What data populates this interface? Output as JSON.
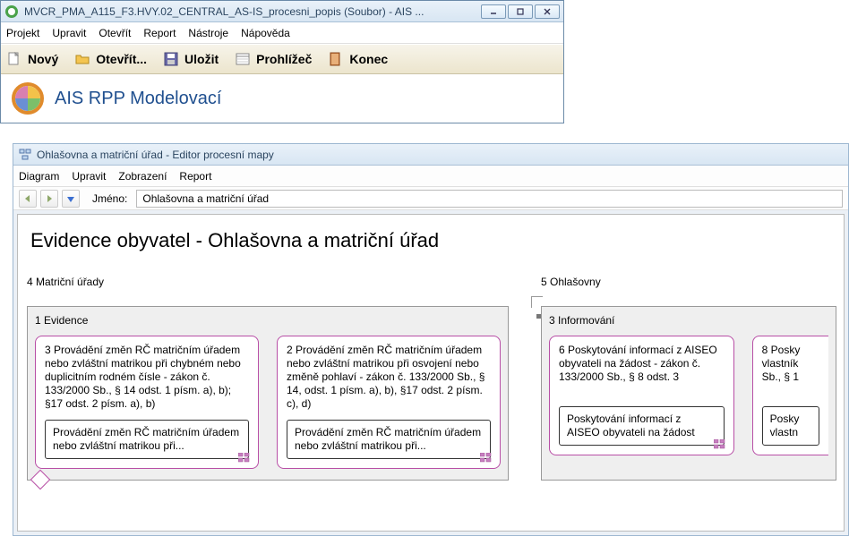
{
  "parentWindow": {
    "title": "MVCR_PMA_A115_F3.HVY.02_CENTRAL_AS-IS_procesni_popis (Soubor) - AIS ..."
  },
  "parentMenu": [
    "Projekt",
    "Upravit",
    "Otevřít",
    "Report",
    "Nástroje",
    "Nápověda"
  ],
  "toolbar": {
    "novy": "Nový",
    "otevrit": "Otevřít...",
    "ulozit": "Uložit",
    "prohlizec": "Prohlížeč",
    "konec": "Konec"
  },
  "brand": "AIS RPP Modelovací",
  "editor": {
    "title": "Ohlašovna a matriční úřad - Editor procesní mapy",
    "menu": [
      "Diagram",
      "Upravit",
      "Zobrazení",
      "Report"
    ],
    "nameLabel": "Jméno:",
    "nameValue": "Ohlašovna a matriční úřad",
    "heading": "Evidence obyvatel - Ohlašovna a matriční úřad"
  },
  "lanes": {
    "left": {
      "title": "4 Matriční úřady"
    },
    "right": {
      "title": "5 Ohlašovny"
    }
  },
  "panes": {
    "evidence": {
      "title": "1 Evidence"
    },
    "informovani": {
      "title": "3 Informování"
    }
  },
  "cards": {
    "c1": {
      "title": "3 Provádění změn RČ matričním úřadem nebo zvláštní matrikou při chybném nebo duplicitním rodném čísle - zákon č. 133/2000 Sb., § 14 odst. 1 písm. a), b); §17 odst. 2 písm. a), b)",
      "sub": "Provádění změn RČ matričním úřadem nebo zvláštní matrikou při..."
    },
    "c2": {
      "title": "2 Provádění změn RČ matričním úřadem nebo zvláštní matrikou při osvojení nebo změně pohlaví - zákon č. 133/2000 Sb., § 14, odst. 1 písm. a), b), §17 odst. 2 písm. c), d)",
      "sub": "Provádění změn RČ matričním úřadem nebo zvláštní matrikou při..."
    },
    "c3": {
      "title": "6 Poskytování informací z AISEO obyvateli na žádost - zákon č. 133/2000 Sb., § 8 odst. 3",
      "sub": "Poskytování informací z AISEO obyvateli na žádost"
    },
    "c4": {
      "titleCut": "8 Posky\nvlastník\nSb., § 1",
      "subCut": "Posky\nvlastn"
    }
  }
}
